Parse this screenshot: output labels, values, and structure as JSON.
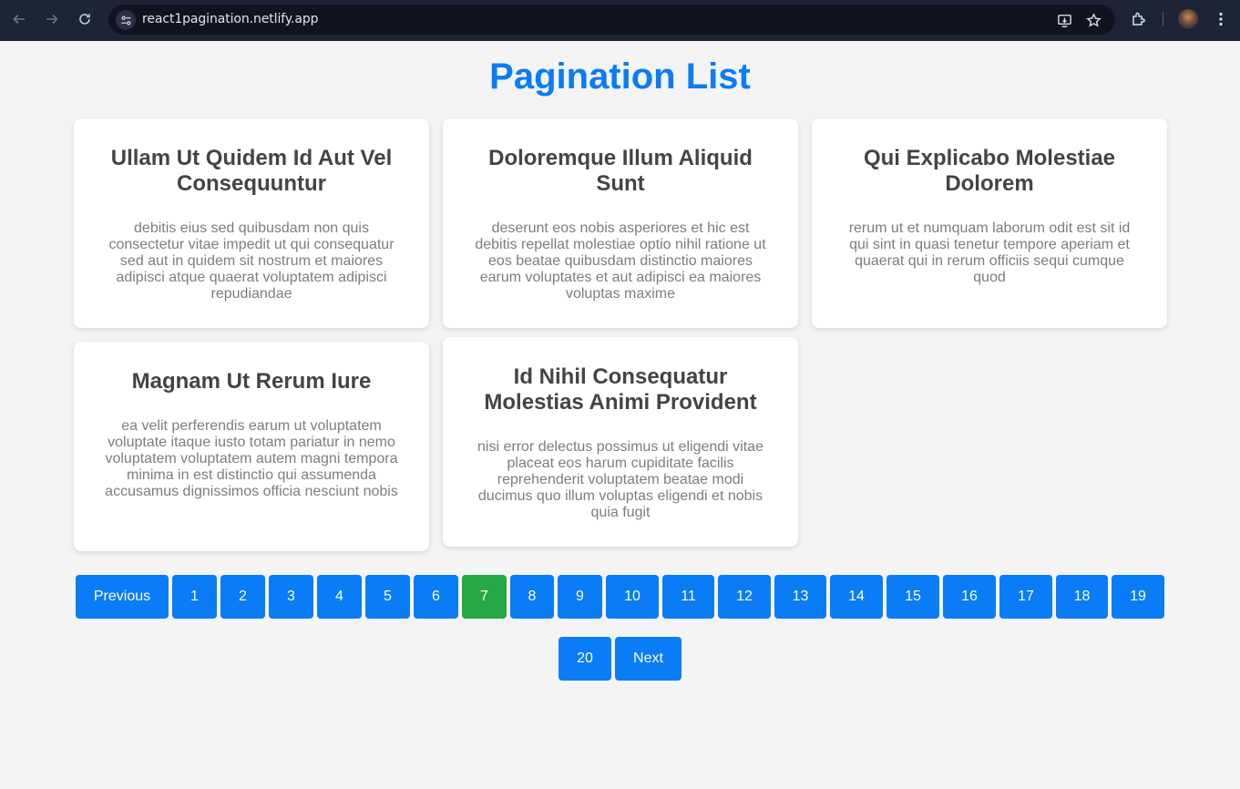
{
  "browser": {
    "url": "react1pagination.netlify.app",
    "icons": [
      "back-icon",
      "forward-icon",
      "reload-icon",
      "site-info-icon",
      "install-app-icon",
      "bookmark-star-icon",
      "extensions-icon",
      "profile-avatar",
      "menu-kebab-icon"
    ]
  },
  "page": {
    "title": "Pagination List"
  },
  "cards": [
    {
      "title": "Ullam Ut Quidem Id Aut Vel Consequuntur",
      "body": "debitis eius sed quibusdam non quis consectetur vitae impedit ut qui consequatur sed aut in quidem sit nostrum et maiores adipisci atque quaerat voluptatem adipisci repudiandae"
    },
    {
      "title": "Doloremque Illum Aliquid Sunt",
      "body": "deserunt eos nobis asperiores et hic est debitis repellat molestiae optio nihil ratione ut eos beatae quibusdam distinctio maiores earum voluptates et aut adipisci ea maiores voluptas maxime"
    },
    {
      "title": "Qui Explicabo Molestiae Dolorem",
      "body": "rerum ut et numquam laborum odit est sit id qui sint in quasi tenetur tempore aperiam et quaerat qui in rerum officiis sequi cumque quod"
    },
    {
      "title": "Magnam Ut Rerum Iure",
      "body": "ea velit perferendis earum ut voluptatem voluptate itaque iusto totam pariatur in nemo voluptatem voluptatem autem magni tempora minima in est distinctio qui assumenda accusamus dignissimos officia nesciunt nobis"
    },
    {
      "title": "Id Nihil Consequatur Molestias Animi Provident",
      "body": "nisi error delectus possimus ut eligendi vitae placeat eos harum cupiditate facilis reprehenderit voluptatem beatae modi ducimus quo illum voluptas eligendi et nobis quia fugit"
    }
  ],
  "pagination": {
    "previous_label": "Previous",
    "next_label": "Next",
    "pages": [
      "1",
      "2",
      "3",
      "4",
      "5",
      "6",
      "7",
      "8",
      "9",
      "10",
      "11",
      "12",
      "13",
      "14",
      "15",
      "16",
      "17",
      "18",
      "19",
      "20"
    ],
    "current_page": "7",
    "colors": {
      "button": "#0a7cf5",
      "active": "#28a745"
    }
  }
}
